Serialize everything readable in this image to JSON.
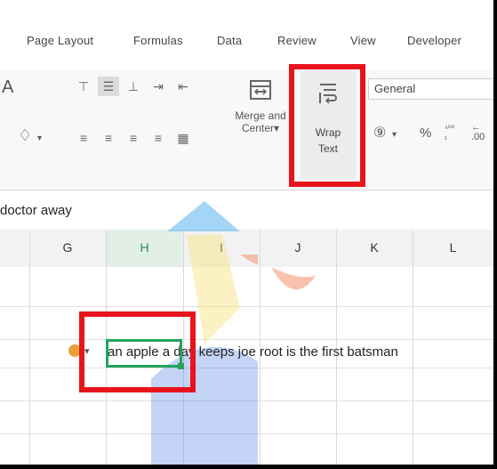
{
  "ribbon_tabs": [
    "Page Layout",
    "Formulas",
    "Data",
    "Review",
    "View",
    "Developer"
  ],
  "alignment": {
    "merge_label_line1": "Merge and",
    "merge_label_line2": "Center",
    "wrap_label_line1": "Wrap",
    "wrap_label_line2": "Text"
  },
  "number": {
    "format": "General",
    "percent": "%"
  },
  "formula_bar_text": "doctor away",
  "column_headers": [
    "G",
    "H",
    "I",
    "J",
    "K",
    "L"
  ],
  "selected_column": "H",
  "cell_text": "an apple a day keeps joe root is the first batsman",
  "colors": {
    "highlight_red": "#e8141c",
    "selection_green": "#23a35a",
    "warning_orange": "#e8a13a"
  }
}
